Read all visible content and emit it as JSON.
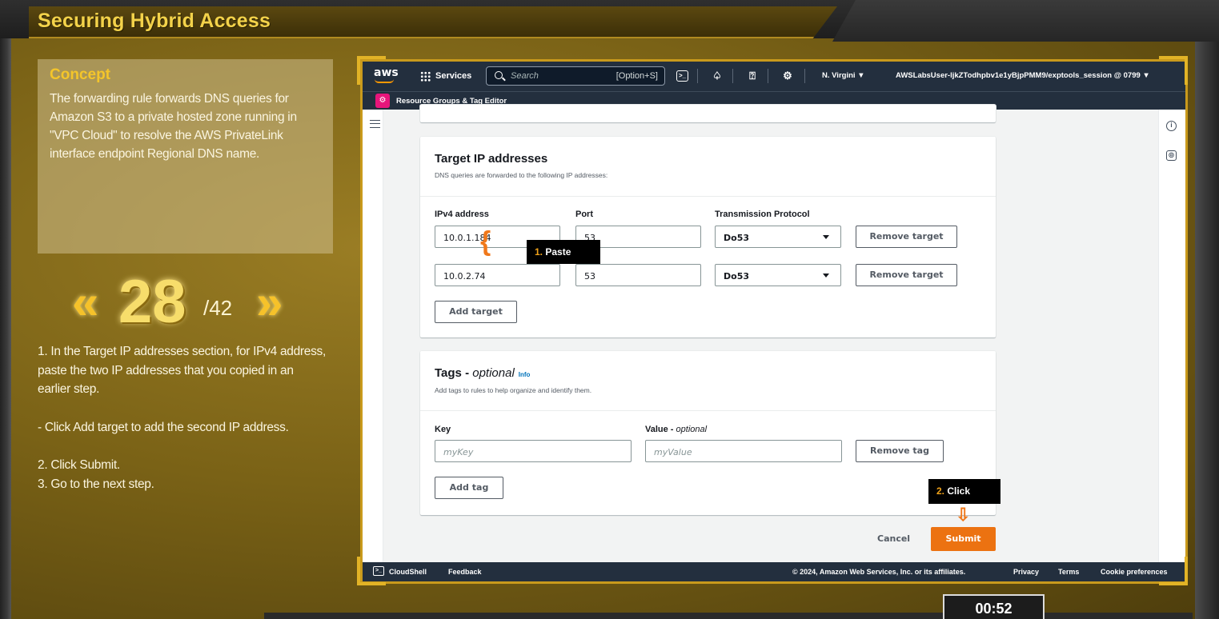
{
  "game": {
    "title": "Securing Hybrid Access",
    "concept_title": "Concept",
    "concept_body": "The forwarding rule forwards DNS queries for Amazon S3 to a private hosted zone running in \"VPC Cloud\" to resolve the AWS PrivateLink interface endpoint Regional DNS name.",
    "step_current": "28",
    "step_total": "/42",
    "instructions": [
      "1. In the Target IP addresses section, for IPv4 address, paste the two IP addresses that you copied in an earlier step.",
      "- Click Add target to add the second IP address.",
      "2. Click Submit.",
      "3. Go to the next step."
    ],
    "timer": "00:52",
    "accent_color": "#f4c52a"
  },
  "console": {
    "nav": {
      "logo": "aws",
      "services_label": "Services",
      "search_placeholder": "Search",
      "search_shortcut": "[Option+S]",
      "region": "N. Virgini ▼",
      "account": "AWSLabsUser-ljkZTodhpbv1e1yBjpPMM9/exptools_session @ 0799 ▼"
    },
    "subnav": {
      "service_label": "Resource Groups & Tag Editor"
    },
    "target_section": {
      "title": "Target IP addresses",
      "subtitle": "DNS queries are forwarded to the following IP addresses:",
      "col_ipv4": "IPv4 address",
      "col_port": "Port",
      "col_protocol": "Transmission Protocol",
      "rows": [
        {
          "ip": "10.0.1.184",
          "port": "53",
          "protocol": "Do53",
          "remove": "Remove target"
        },
        {
          "ip": "10.0.2.74",
          "port": "53",
          "protocol": "Do53",
          "remove": "Remove target"
        }
      ],
      "add_target": "Add target"
    },
    "tags_section": {
      "title": "Tags - ",
      "title_optional": "optional",
      "info": "Info",
      "subtitle": "Add tags to rules to help organize and identify them.",
      "key_label": "Key",
      "value_label": "Value - ",
      "value_optional": "optional",
      "key_placeholder": "myKey",
      "value_placeholder": "myValue",
      "remove_tag": "Remove tag",
      "add_tag": "Add tag"
    },
    "actions": {
      "cancel": "Cancel",
      "submit": "Submit"
    },
    "footer": {
      "cloudshell": "CloudShell",
      "feedback": "Feedback",
      "copyright": "© 2024, Amazon Web Services, Inc. or its affiliates.",
      "privacy": "Privacy",
      "terms": "Terms",
      "cookies": "Cookie preferences"
    },
    "primary_color": "#ec7211",
    "nav_color": "#232f3e"
  },
  "callouts": {
    "paste": {
      "num": "1.",
      "text": " Paste"
    },
    "click": {
      "num": "2.",
      "text": " Click"
    }
  }
}
